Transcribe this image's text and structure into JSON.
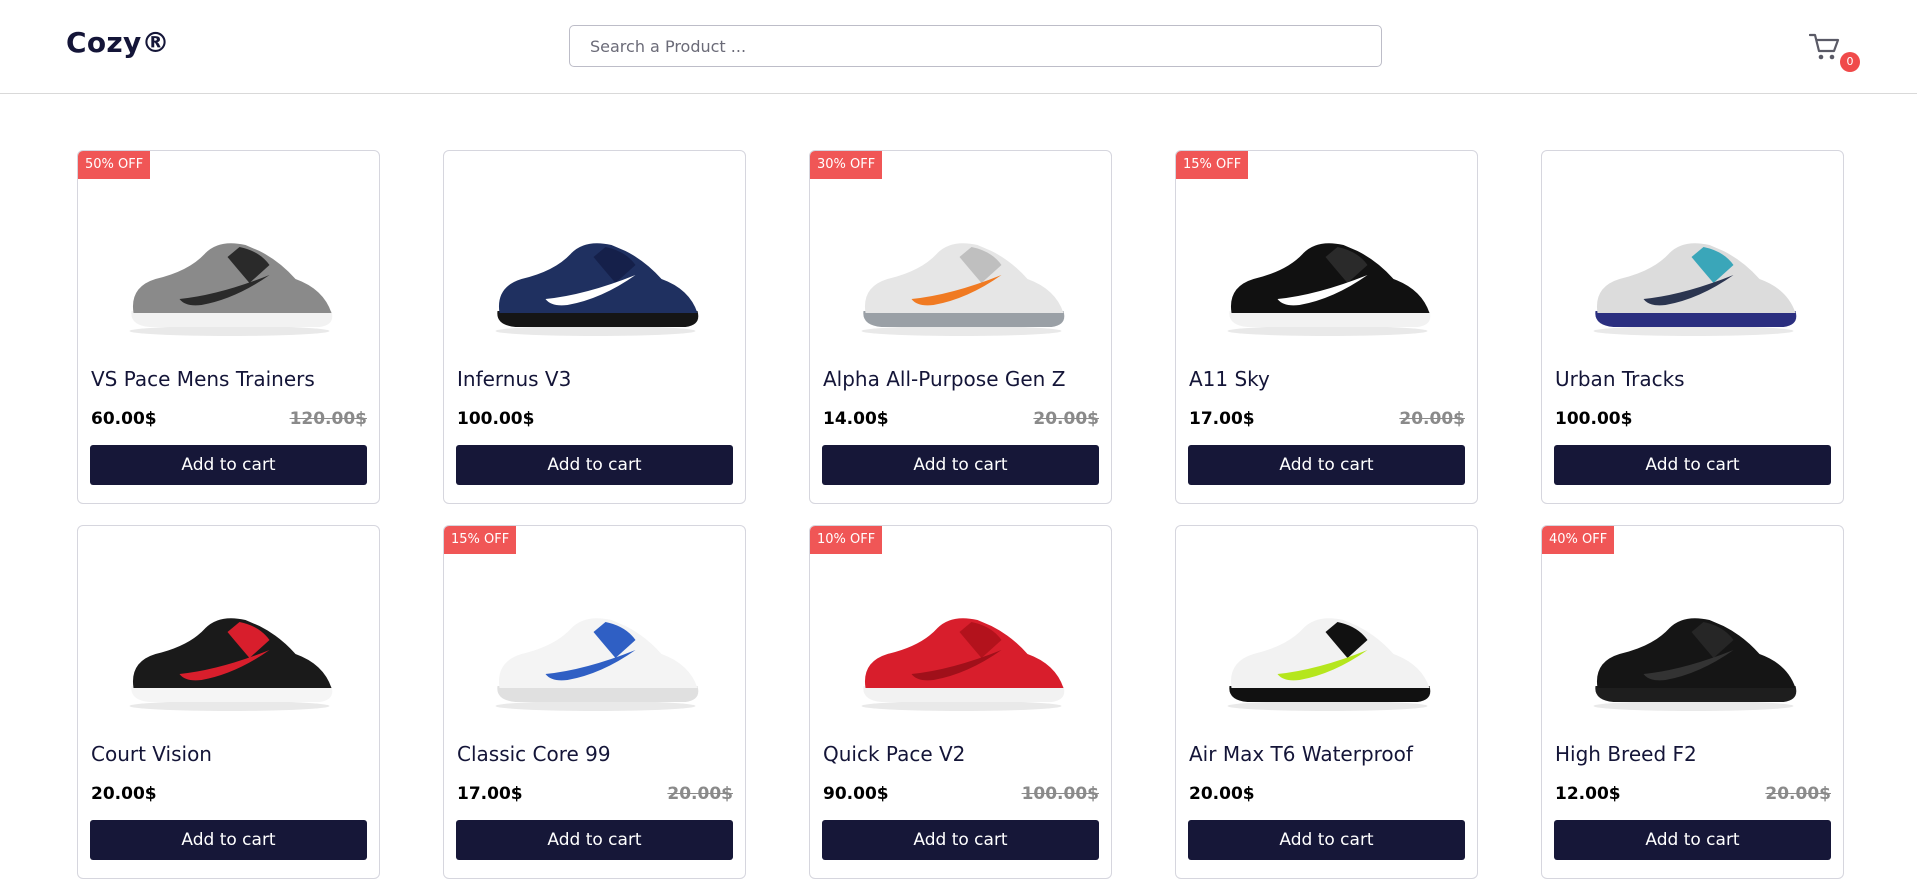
{
  "header": {
    "logo": "Cozy®",
    "search_placeholder": "Search a Product ...",
    "cart_count": "0"
  },
  "products": [
    {
      "name": "VS Pace Mens Trainers",
      "price": "60.00$",
      "old_price": "120.00$",
      "badge": "50% OFF",
      "button": "Add to cart",
      "colors": {
        "upper": "#8a8a8a",
        "accent": "#2a2a2a",
        "sole": "#f2f2f2",
        "swoosh": "#2a2a2a"
      }
    },
    {
      "name": "Infernus V3",
      "price": "100.00$",
      "old_price": "",
      "badge": "",
      "button": "Add to cart",
      "colors": {
        "upper": "#1f3060",
        "accent": "#15204a",
        "sole": "#151515",
        "swoosh": "#ffffff"
      }
    },
    {
      "name": "Alpha All-Purpose Gen Z",
      "price": "14.00$",
      "old_price": "20.00$",
      "badge": "30% OFF",
      "button": "Add to cart",
      "colors": {
        "upper": "#e6e6e6",
        "accent": "#bfbfbf",
        "sole": "#9aa0a6",
        "swoosh": "#f07a22"
      }
    },
    {
      "name": "A11 Sky",
      "price": "17.00$",
      "old_price": "20.00$",
      "badge": "15% OFF",
      "button": "Add to cart",
      "colors": {
        "upper": "#111111",
        "accent": "#2a2a2a",
        "sole": "#f2f2f2",
        "swoosh": "#ffffff"
      }
    },
    {
      "name": "Urban Tracks",
      "price": "100.00$",
      "old_price": "",
      "badge": "",
      "button": "Add to cart",
      "colors": {
        "upper": "#dcdcdc",
        "accent": "#3aa6b9",
        "sole": "#2b2f80",
        "swoosh": "#2b3550"
      }
    },
    {
      "name": "Court Vision",
      "price": "20.00$",
      "old_price": "",
      "badge": "",
      "button": "Add to cart",
      "colors": {
        "upper": "#1a1a1a",
        "accent": "#d81e2c",
        "sole": "#f5f5f5",
        "swoosh": "#d81e2c"
      }
    },
    {
      "name": "Classic Core 99",
      "price": "17.00$",
      "old_price": "20.00$",
      "badge": "15% OFF",
      "button": "Add to cart",
      "colors": {
        "upper": "#f4f4f4",
        "accent": "#2f5fc4",
        "sole": "#e0e0e0",
        "swoosh": "#2f5fc4"
      }
    },
    {
      "name": "Quick Pace V2",
      "price": "90.00$",
      "old_price": "100.00$",
      "badge": "10% OFF",
      "button": "Add to cart",
      "colors": {
        "upper": "#d81e2c",
        "accent": "#b3121c",
        "sole": "#f2f2f2",
        "swoosh": "#a0101a"
      }
    },
    {
      "name": "Air Max T6 Waterproof",
      "price": "20.00$",
      "old_price": "",
      "badge": "",
      "button": "Add to cart",
      "colors": {
        "upper": "#f2f2f2",
        "accent": "#111111",
        "sole": "#111111",
        "swoosh": "#b5e61d"
      }
    },
    {
      "name": "High Breed F2",
      "price": "12.00$",
      "old_price": "20.00$",
      "badge": "40% OFF",
      "button": "Add to cart",
      "colors": {
        "upper": "#151515",
        "accent": "#262626",
        "sole": "#1e1e1e",
        "swoosh": "#333333"
      }
    }
  ]
}
